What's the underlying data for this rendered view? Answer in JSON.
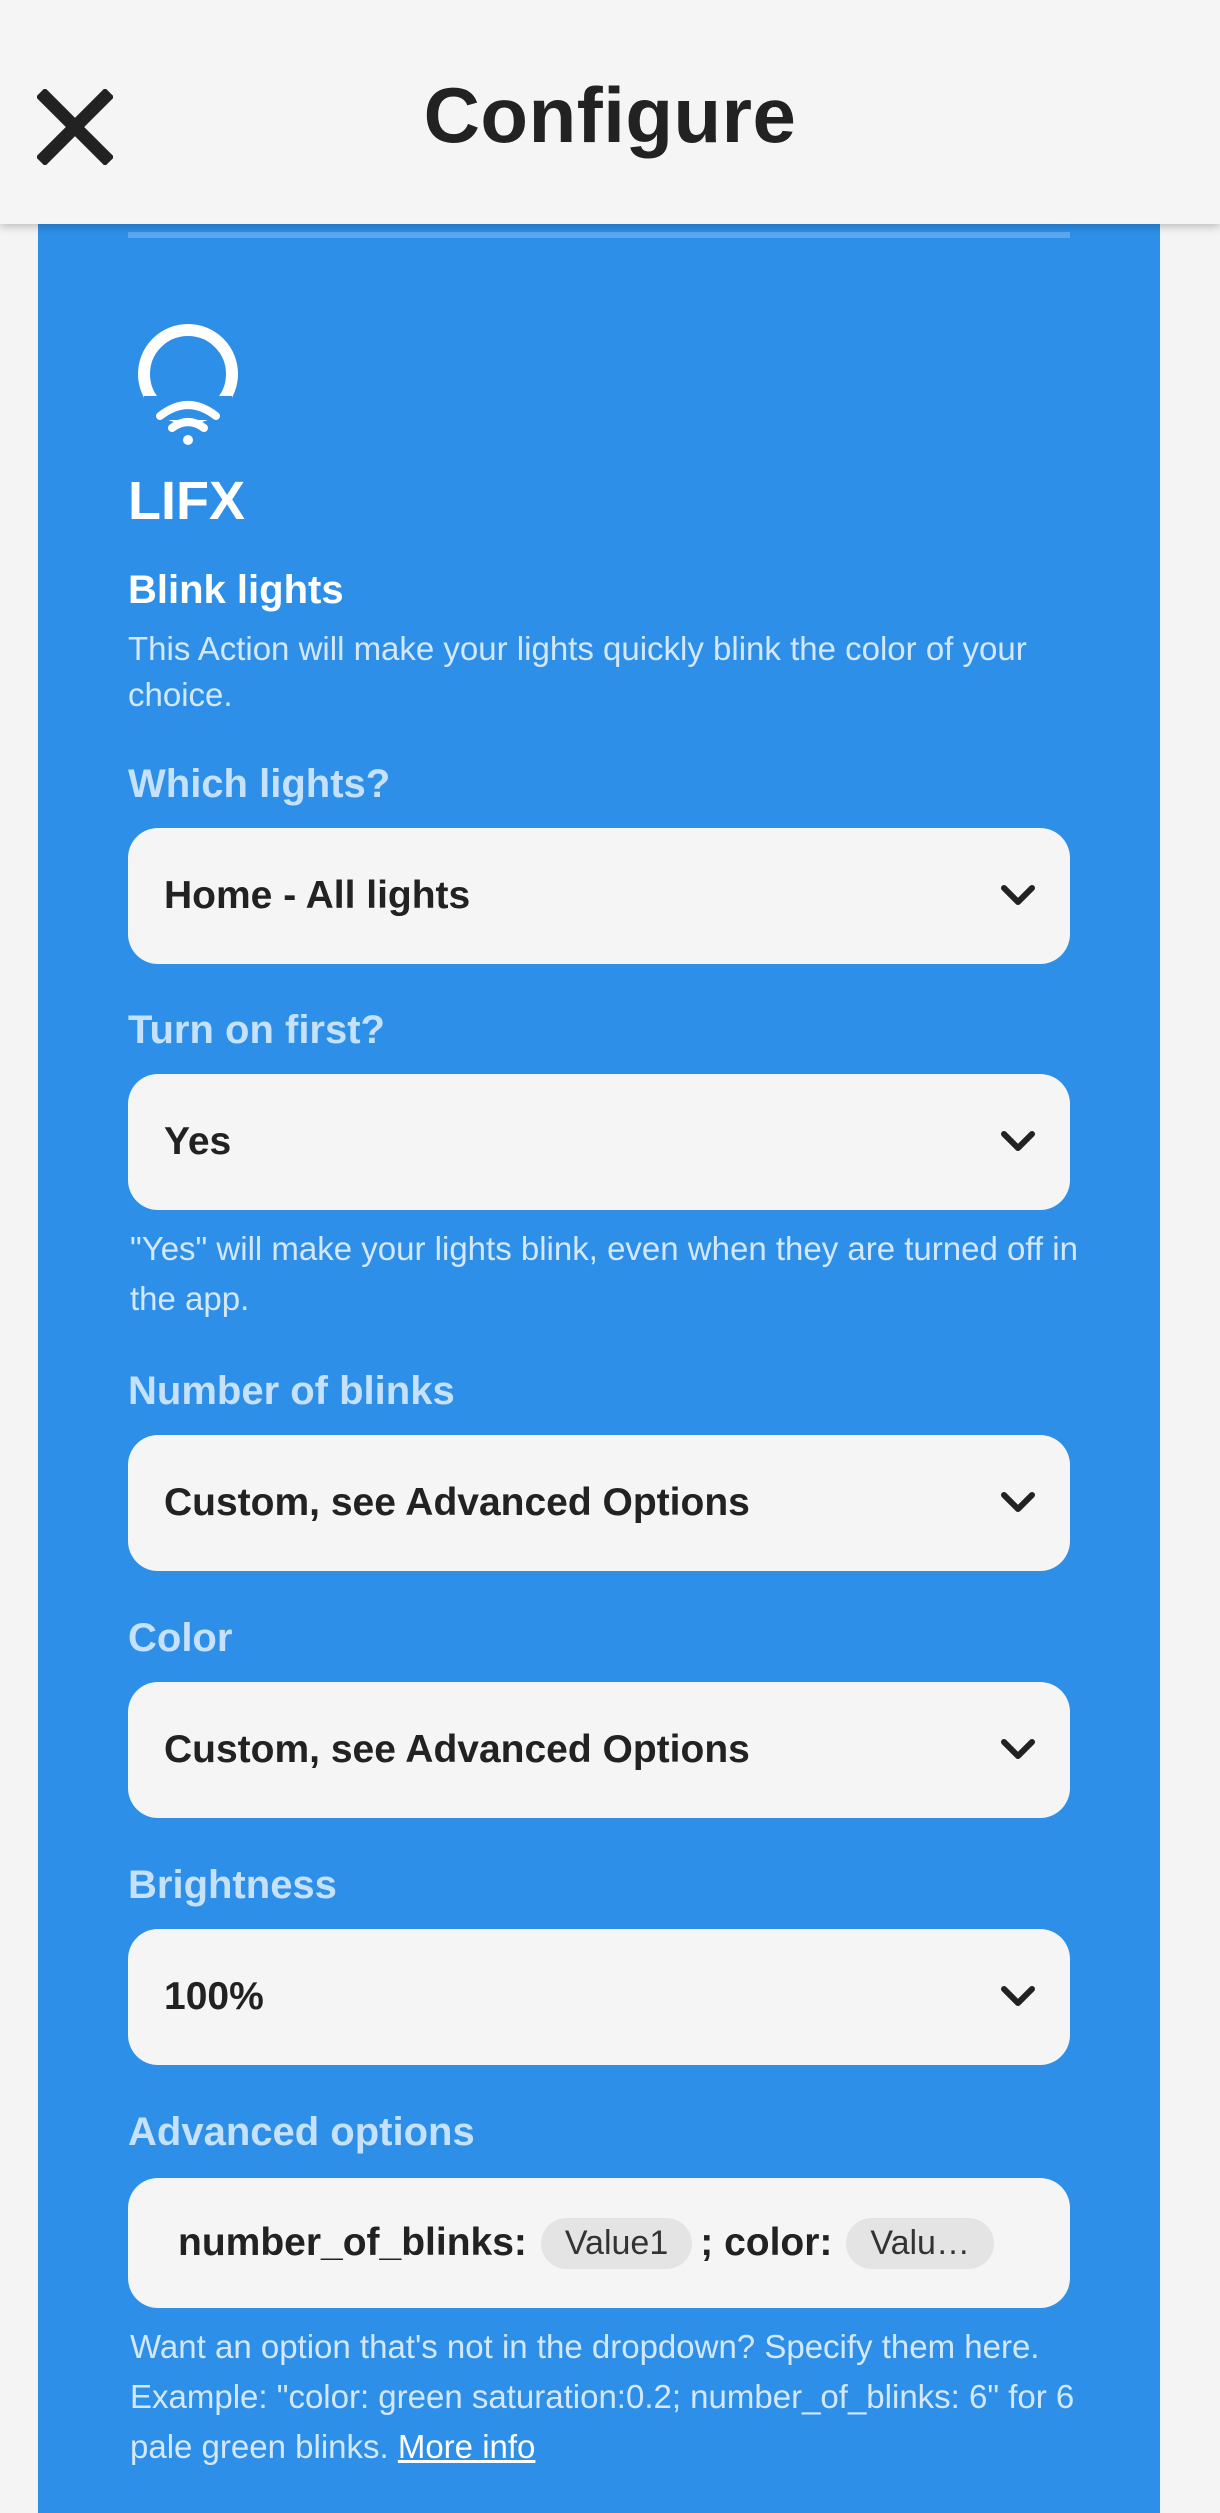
{
  "header": {
    "title": "Configure"
  },
  "service": {
    "name": "LIFX"
  },
  "action": {
    "title": "Blink lights",
    "description": "This Action will make your lights quickly blink the color of your choice."
  },
  "fields": {
    "which_lights": {
      "label": "Which lights?",
      "value": "Home - All lights"
    },
    "turn_on_first": {
      "label": "Turn on first?",
      "value": "Yes",
      "helper": "\"Yes\" will make your lights blink, even when they are turned off in the app."
    },
    "number_of_blinks": {
      "label": "Number of blinks",
      "value": "Custom, see Advanced Options"
    },
    "color": {
      "label": "Color",
      "value": "Custom, see Advanced Options"
    },
    "brightness": {
      "label": "Brightness",
      "value": "100%"
    },
    "advanced": {
      "label": "Advanced options",
      "part1": "number_of_blinks:",
      "pill1": "Value1",
      "part2": "; color:",
      "pill2": "Valu…",
      "helper": "Want an option that's not in the dropdown? Specify them here. Example: \"color: green saturation:0.2; number_of_blinks: 6\" for 6 pale green blinks.",
      "more_info": "More info"
    }
  },
  "icons": {
    "close": "close-icon",
    "service_logo": "lifx-bulb-icon",
    "dropdown": "chevron-down-icon"
  },
  "colors": {
    "accent": "#2e8fe9",
    "background": "#f4f4f4",
    "field": "#f5f5f5"
  }
}
